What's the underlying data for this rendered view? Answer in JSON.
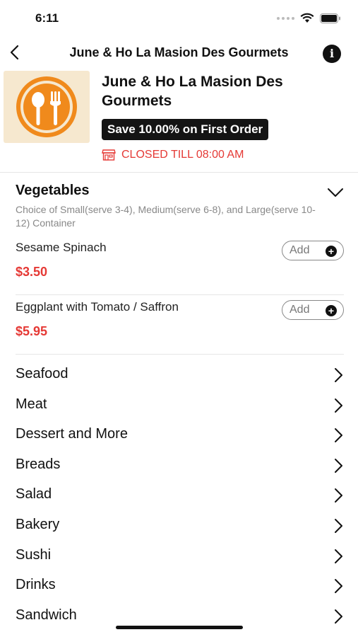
{
  "status_bar": {
    "time": "6:11"
  },
  "nav": {
    "title": "June & Ho La Masion Des Gourmets",
    "back_icon": "chevron-left-icon",
    "info_icon": "info-icon"
  },
  "store": {
    "name": "June & Ho La Masion Des Gourmets",
    "promo": "Save 10.00% on First Order",
    "status": "CLOSED TILL 08:00 AM",
    "accent_color": "#e53935",
    "logo_color": "#f08a1c"
  },
  "expanded_category": {
    "title": "Vegetables",
    "description": "Choice of Small(serve 3-4), Medium(serve 6-8), and Large(serve 10-12) Container",
    "items": [
      {
        "name": "Sesame Spinach",
        "price": "$3.50",
        "add_label": "Add"
      },
      {
        "name": "Eggplant with Tomato / Saffron",
        "price": "$5.95",
        "add_label": "Add"
      }
    ]
  },
  "categories": [
    {
      "label": "Seafood"
    },
    {
      "label": "Meat"
    },
    {
      "label": "Dessert and More"
    },
    {
      "label": "Breads"
    },
    {
      "label": "Salad"
    },
    {
      "label": "Bakery"
    },
    {
      "label": "Sushi"
    },
    {
      "label": "Drinks"
    },
    {
      "label": "Sandwich"
    }
  ]
}
